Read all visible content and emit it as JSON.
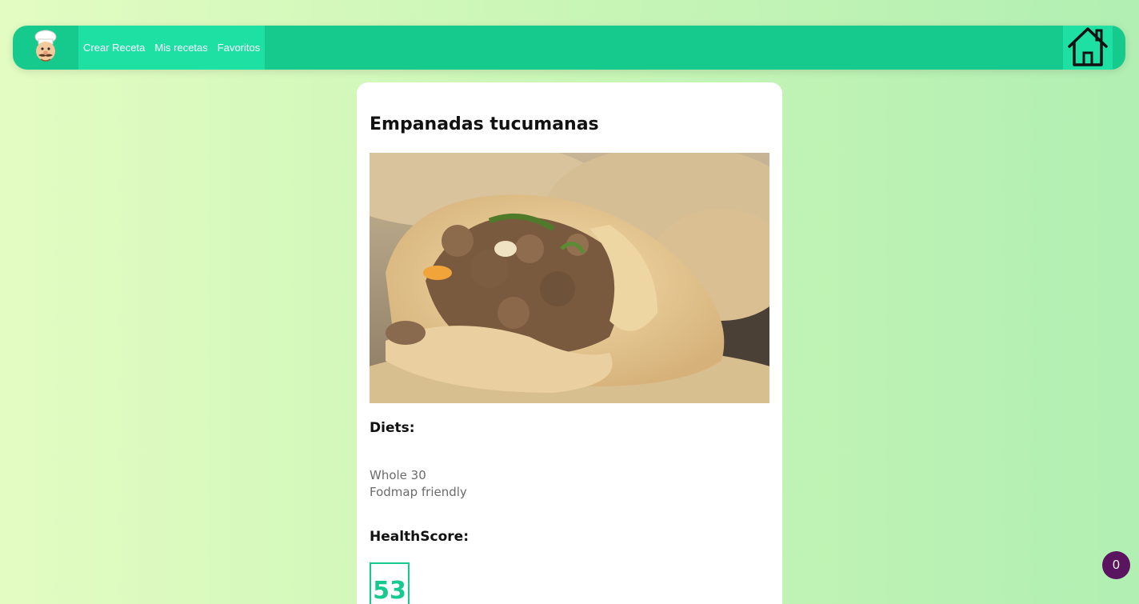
{
  "navbar": {
    "logo_icon": "chef-icon",
    "links": [
      {
        "label": "Crear Receta"
      },
      {
        "label": "Mis recetas"
      },
      {
        "label": "Favoritos"
      }
    ],
    "home_icon": "home-icon",
    "colors": {
      "bar": "#16c98c",
      "highlight": "#1ee0a3"
    }
  },
  "recipe": {
    "title": "Empanadas tucumanas",
    "image_icon": "empanada-photo",
    "diets_label": "Diets:",
    "diets": [
      "Whole 30",
      "Fodmap friendly"
    ],
    "health_label": "HealthScore:",
    "health_score": "53"
  },
  "favorites_badge": {
    "count": "0",
    "color": "#5a1460"
  }
}
